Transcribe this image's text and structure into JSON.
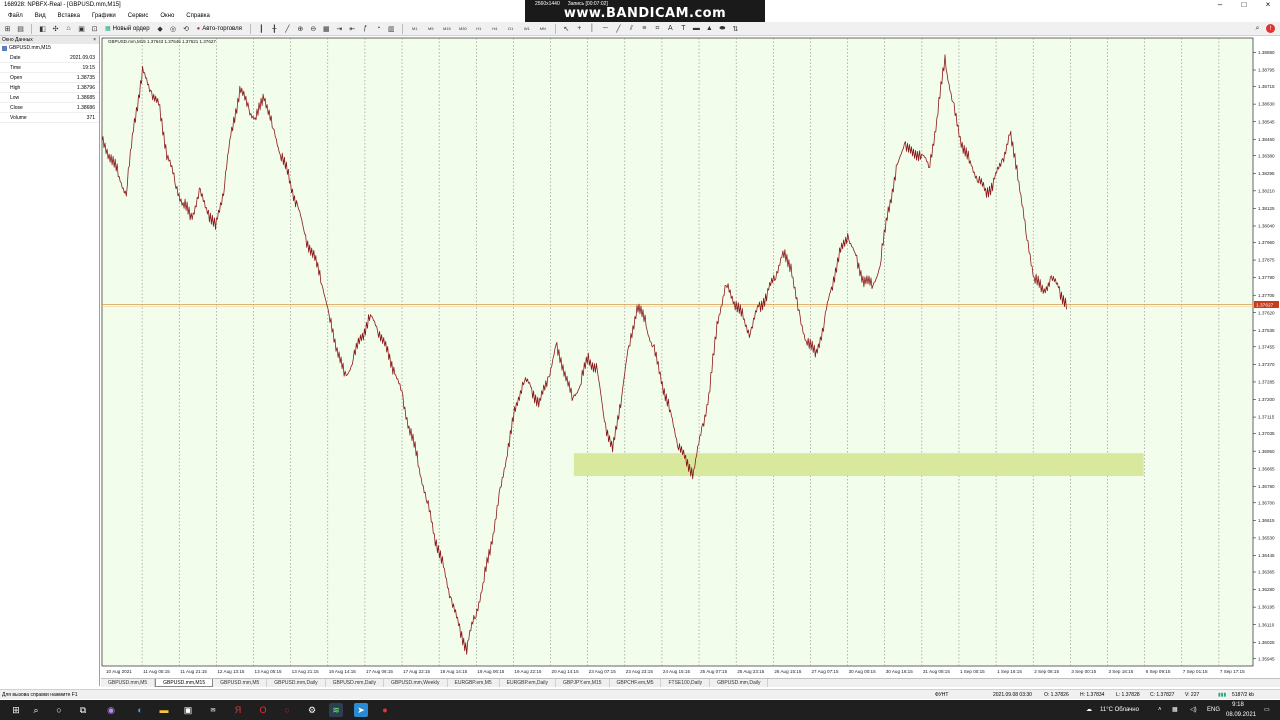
{
  "window": {
    "title": "168928: NPBFX-Real - [GBPUSD.mm,M15]"
  },
  "bandicam": {
    "resolution": "2560x1440",
    "logo": "www.BANDICAM.com",
    "rec_label": "Запись [00:07:02]"
  },
  "menu": [
    "Файл",
    "Вид",
    "Вставка",
    "Графики",
    "Сервис",
    "Окно",
    "Справка"
  ],
  "toolbar": {
    "new_order": "Новый ордер",
    "auto_trading": "Авто-торговля",
    "timeframes": [
      "M1",
      "M5",
      "M15",
      "M30",
      "H1",
      "H4",
      "D1",
      "W1",
      "MN"
    ]
  },
  "data_window": {
    "title": "Окно Данных",
    "symbol": "GBPUSD.mm,M15",
    "rows": [
      {
        "k": "Date",
        "v": "2021.09.03"
      },
      {
        "k": "Time",
        "v": "19:15"
      },
      {
        "k": "Open",
        "v": "1.38735"
      },
      {
        "k": "High",
        "v": "1.38796"
      },
      {
        "k": "Low",
        "v": "1.38685"
      },
      {
        "k": "Close",
        "v": "1.38686"
      },
      {
        "k": "Volume",
        "v": "371"
      }
    ]
  },
  "chart_data": {
    "type": "line",
    "header": "GBPUSD.mm,M15  1.37643 1.37646 1.37621 1.37627",
    "current_price": "1.37627",
    "ylim": [
      1.3591,
      1.3895
    ],
    "y_ticks": [
      "1.38880",
      "1.38795",
      "1.38715",
      "1.38630",
      "1.38545",
      "1.38460",
      "1.38380",
      "1.38295",
      "1.38210",
      "1.38125",
      "1.38040",
      "1.37960",
      "1.37875",
      "1.37790",
      "1.37705",
      "1.37620",
      "1.37535",
      "1.37455",
      "1.37370",
      "1.37285",
      "1.37200",
      "1.37115",
      "1.37035",
      "1.36950",
      "1.36865",
      "1.36780",
      "1.36700",
      "1.36615",
      "1.36530",
      "1.36445",
      "1.36365",
      "1.36280",
      "1.36195",
      "1.36110",
      "1.36025",
      "1.35945"
    ],
    "x_labels": [
      "10 Aug 2021",
      "11 Aug 05:15",
      "11 Aug 21:15",
      "12 Aug 13:15",
      "13 Aug 05:15",
      "13 Aug 21:15",
      "16 Aug 14:15",
      "17 Aug 06:15",
      "17 Aug 22:15",
      "18 Aug 14:15",
      "19 Aug 06:15",
      "19 Aug 22:15",
      "20 Aug 14:15",
      "23 Aug 07:15",
      "23 Aug 23:15",
      "24 Aug 15:15",
      "25 Aug 07:15",
      "25 Aug 23:15",
      "26 Aug 15:15",
      "27 Aug 07:15",
      "30 Aug 00:15",
      "30 Aug 16:15",
      "31 Aug 08:15",
      "1 Sep 00:15",
      "1 Sep 16:15",
      "2 Sep 08:15",
      "3 Sep 00:15",
      "3 Sep 16:15",
      "6 Sep 09:15",
      "7 Sep 01:15",
      "7 Sep 17:15"
    ],
    "horizontal_line": 1.3766,
    "zone": {
      "x_start": 0.41,
      "x_end": 0.905,
      "y_top": 1.3694,
      "y_bottom": 1.3683,
      "color": "#d6e89a"
    },
    "series": [
      {
        "values": [
          1.3845,
          1.3838,
          1.3829,
          1.382,
          1.3855,
          1.3878,
          1.387,
          1.3862,
          1.384,
          1.3825,
          1.3815,
          1.3808,
          1.382,
          1.3812,
          1.3803,
          1.3822,
          1.385,
          1.387,
          1.3862,
          1.3855,
          1.3868,
          1.3852,
          1.384,
          1.3828,
          1.3815,
          1.38,
          1.379,
          1.378,
          1.376,
          1.3745,
          1.373,
          1.374,
          1.375,
          1.376,
          1.3755,
          1.3745,
          1.3735,
          1.3722,
          1.3705,
          1.369,
          1.3672,
          1.3655,
          1.364,
          1.3625,
          1.361,
          1.36,
          1.3615,
          1.363,
          1.365,
          1.3672,
          1.3695,
          1.3715,
          1.373,
          1.3725,
          1.3718,
          1.373,
          1.3745,
          1.3735,
          1.372,
          1.3728,
          1.374,
          1.3735,
          1.371,
          1.3695,
          1.372,
          1.3745,
          1.3765,
          1.3758,
          1.3745,
          1.373,
          1.3715,
          1.37,
          1.369,
          1.3685,
          1.3705,
          1.3725,
          1.376,
          1.3775,
          1.3768,
          1.376,
          1.3752,
          1.3765,
          1.377,
          1.378,
          1.379,
          1.3785,
          1.376,
          1.3748,
          1.3742,
          1.3755,
          1.3775,
          1.379,
          1.38,
          1.3788,
          1.3778,
          1.3775,
          1.3785,
          1.3812,
          1.383,
          1.3845,
          1.3838,
          1.384,
          1.3832,
          1.3855,
          1.3885,
          1.3862,
          1.3845,
          1.3835,
          1.3828,
          1.382,
          1.3825,
          1.3835,
          1.3848,
          1.383,
          1.38,
          1.378,
          1.3772,
          1.3778,
          1.3775,
          1.3765
        ],
        "color": "#8b1a1a"
      }
    ]
  },
  "tabs": [
    "GBPUSD.mm,M5",
    "GBPUSD.mm,M15",
    "GBPUSD.mm,M5",
    "GBPUSD.mm,Daily",
    "GBPUSD.mm,Daily",
    "GBPUSD.mm,Weekly",
    "EURGBP.em,M5",
    "EURGBP.em,Daily",
    "GBPJPY.em,M15",
    "GBPCHF.em,M5",
    "FTSE100,Daily",
    "GBPUSD.mm,Daily"
  ],
  "active_tab": 1,
  "status": {
    "help": "Для вызова справки нажмите F1",
    "profile": "ФУНТ",
    "datetime": "2021.09.08 03:30",
    "o": "O: 1.37826",
    "h": "H: 1.37834",
    "l": "L: 1.37828",
    "c": "C: 1.37827",
    "v": "V: 227",
    "traffic": "5187/2 kb"
  },
  "taskbar": {
    "weather": "11°C  Облачно",
    "lang": "ENG",
    "time": "9:18",
    "date": "08.09.2021"
  }
}
